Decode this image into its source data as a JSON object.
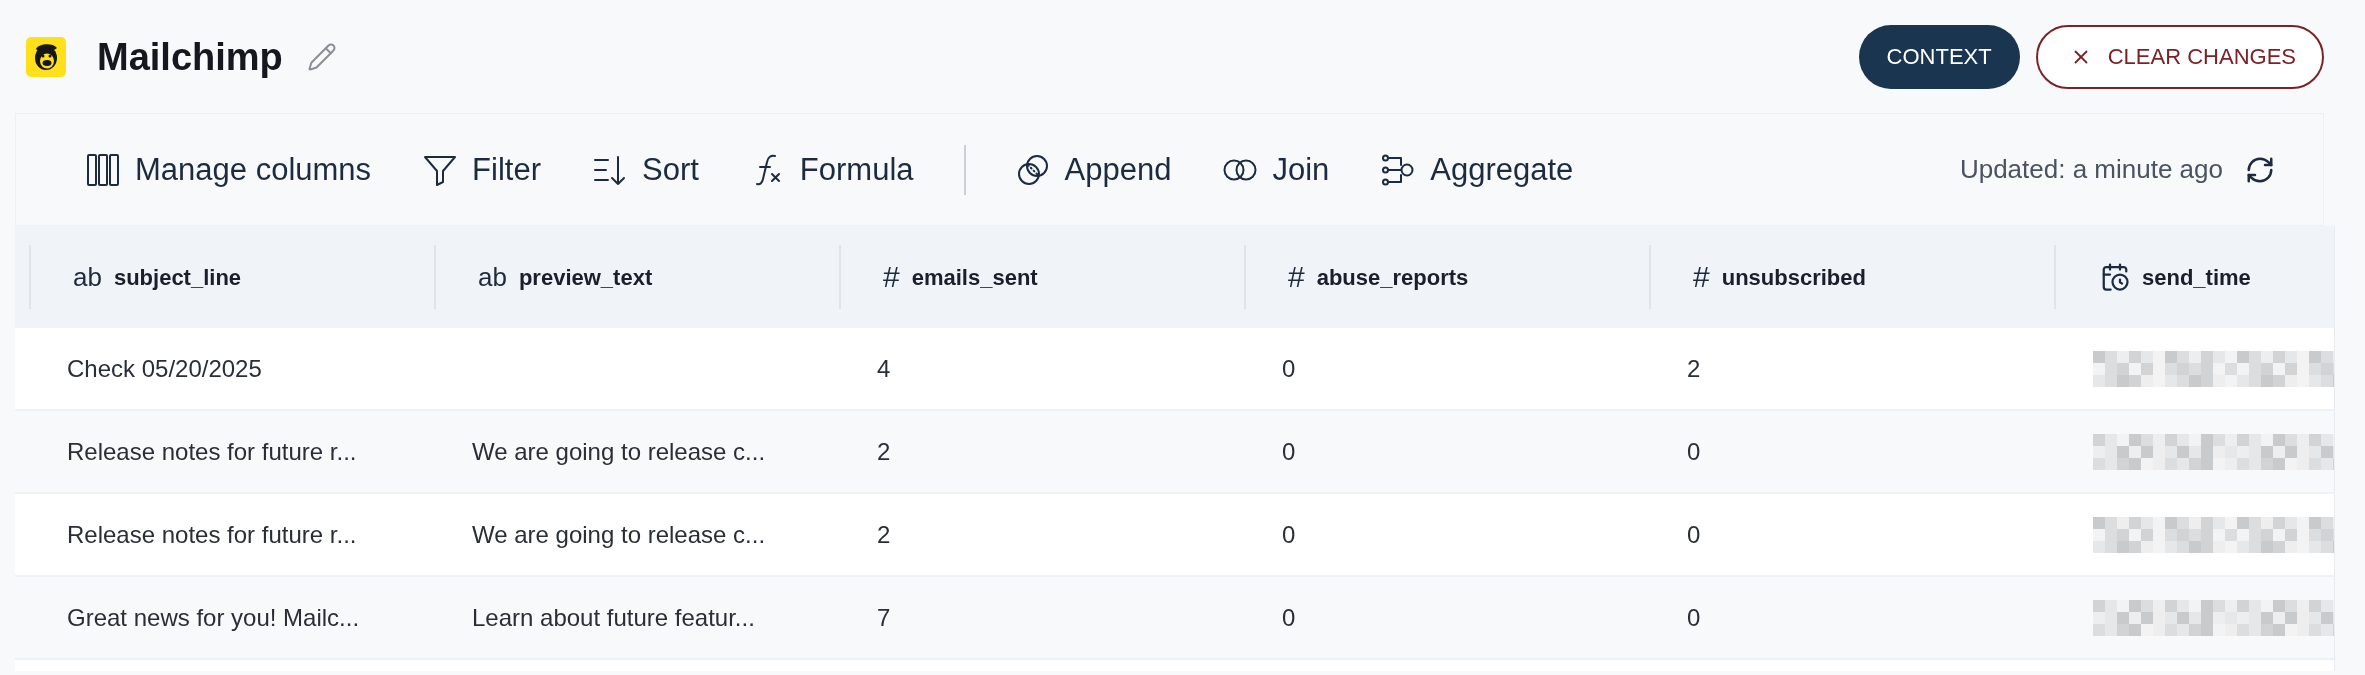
{
  "header": {
    "title": "Mailchimp",
    "buttons": [
      {
        "label": "CONTEXT",
        "kind": "primary"
      },
      {
        "label": "CLEAR CHANGES",
        "kind": "clear"
      }
    ]
  },
  "toolbar": {
    "groups": [
      [
        {
          "label": "Manage columns",
          "kind": "columns"
        },
        {
          "label": "Filter",
          "kind": "filter"
        },
        {
          "label": "Sort",
          "kind": "sort"
        },
        {
          "label": "Formula",
          "kind": "formula"
        }
      ],
      [
        {
          "label": "Append",
          "kind": "append"
        },
        {
          "label": "Join",
          "kind": "join"
        },
        {
          "label": "Aggregate",
          "kind": "aggregate"
        }
      ]
    ],
    "status": "Updated: a minute ago"
  },
  "table": {
    "columns": [
      {
        "kind": "text",
        "symbol": "ab",
        "name": "subject_line"
      },
      {
        "kind": "text",
        "symbol": "ab",
        "name": "preview_text"
      },
      {
        "kind": "number",
        "symbol": "#",
        "name": "emails_sent"
      },
      {
        "kind": "number",
        "symbol": "#",
        "name": "abuse_reports"
      },
      {
        "kind": "number",
        "symbol": "#",
        "name": "unsubscribed"
      },
      {
        "kind": "datetime",
        "name": "send_time"
      }
    ],
    "rows": [
      {
        "cells": [
          {
            "text": "Check 05/20/2025"
          },
          {},
          {
            "text": "4"
          },
          {
            "text": "0"
          },
          {
            "text": "2"
          },
          {
            "obscured": true
          }
        ]
      },
      {
        "cells": [
          {
            "text": "Release notes for future r..."
          },
          {
            "text": "We are going to release c..."
          },
          {
            "text": "2"
          },
          {
            "text": "0"
          },
          {
            "text": "0"
          },
          {
            "obscured": true
          }
        ]
      },
      {
        "cells": [
          {
            "text": "Release notes for future r..."
          },
          {
            "text": "We are going to release c..."
          },
          {
            "text": "2"
          },
          {
            "text": "0"
          },
          {
            "text": "0"
          },
          {
            "obscured": true
          }
        ]
      },
      {
        "cells": [
          {
            "text": "Great news for you! Mailc..."
          },
          {
            "text": "Learn about future featur..."
          },
          {
            "text": "7"
          },
          {
            "text": "0"
          },
          {
            "text": "0"
          },
          {
            "obscured": true
          }
        ]
      }
    ]
  }
}
